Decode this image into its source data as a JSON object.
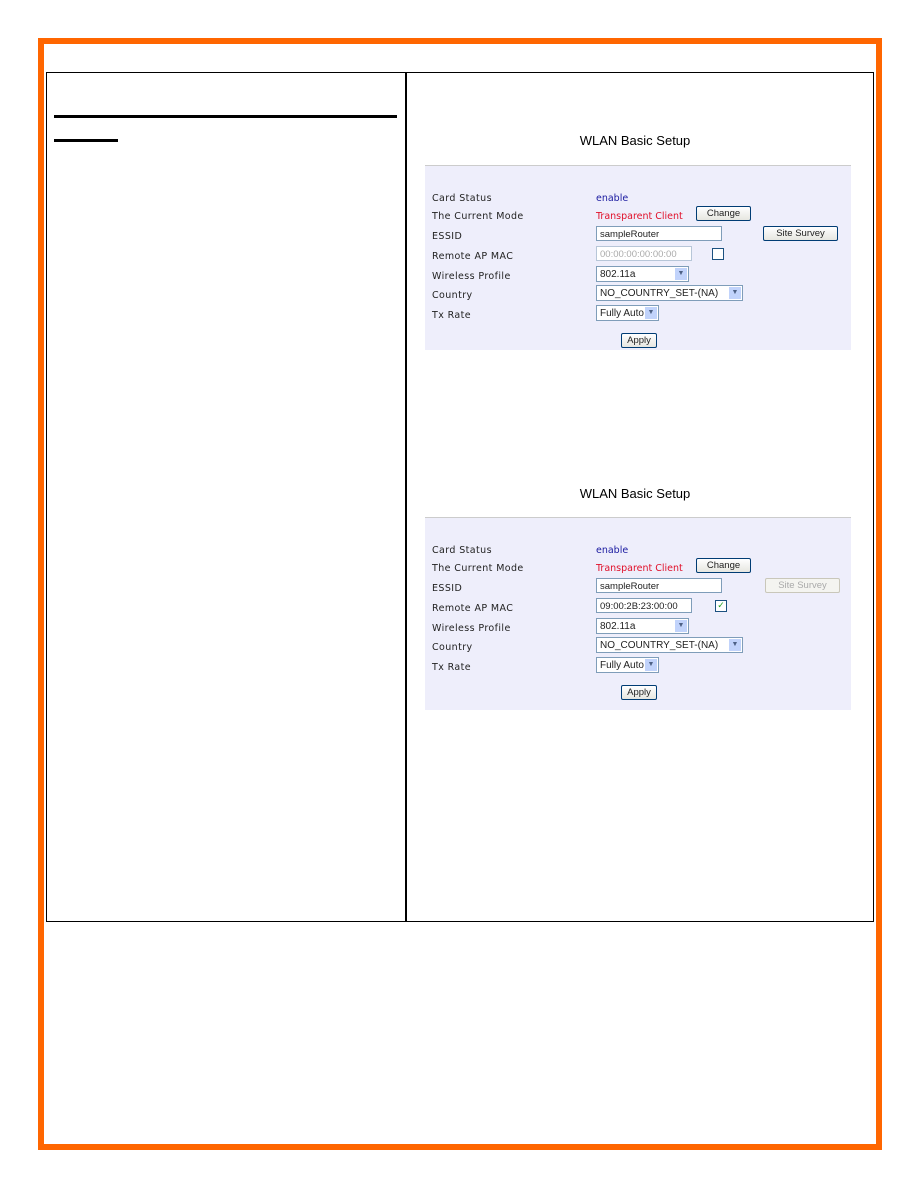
{
  "colors": {
    "border": "#ff6600",
    "enable": "#1a1aa0",
    "mode": "#e0102a",
    "panel": "#eeeefb"
  },
  "panels": [
    {
      "title": "WLAN Basic Setup",
      "card_status_label": "Card Status",
      "card_status": "enable",
      "mode_label": "The Current Mode",
      "mode": "Transparent Client",
      "change": "Change",
      "essid_label": "ESSID",
      "essid": "sampleRouter",
      "site_survey": "Site Survey",
      "site_survey_enabled": true,
      "mac_label": "Remote AP MAC",
      "mac": "00:00:00:00:00:00",
      "mac_enabled": false,
      "mac_checked": false,
      "profile_label": "Wireless Profile",
      "profile": "802.11a",
      "country_label": "Country",
      "country": "NO_COUNTRY_SET-(NA)",
      "txrate_label": "Tx Rate",
      "txrate": "Fully Auto",
      "apply": "Apply"
    },
    {
      "title": "WLAN Basic Setup",
      "card_status_label": "Card Status",
      "card_status": "enable",
      "mode_label": "The Current Mode",
      "mode": "Transparent Client",
      "change": "Change",
      "essid_label": "ESSID",
      "essid": "sampleRouter",
      "site_survey": "Site Survey",
      "site_survey_enabled": false,
      "mac_label": "Remote AP MAC",
      "mac": "09:00:2B:23:00:00",
      "mac_enabled": true,
      "mac_checked": true,
      "profile_label": "Wireless Profile",
      "profile": "802.11a",
      "country_label": "Country",
      "country": "NO_COUNTRY_SET-(NA)",
      "txrate_label": "Tx Rate",
      "txrate": "Fully Auto",
      "apply": "Apply"
    }
  ]
}
